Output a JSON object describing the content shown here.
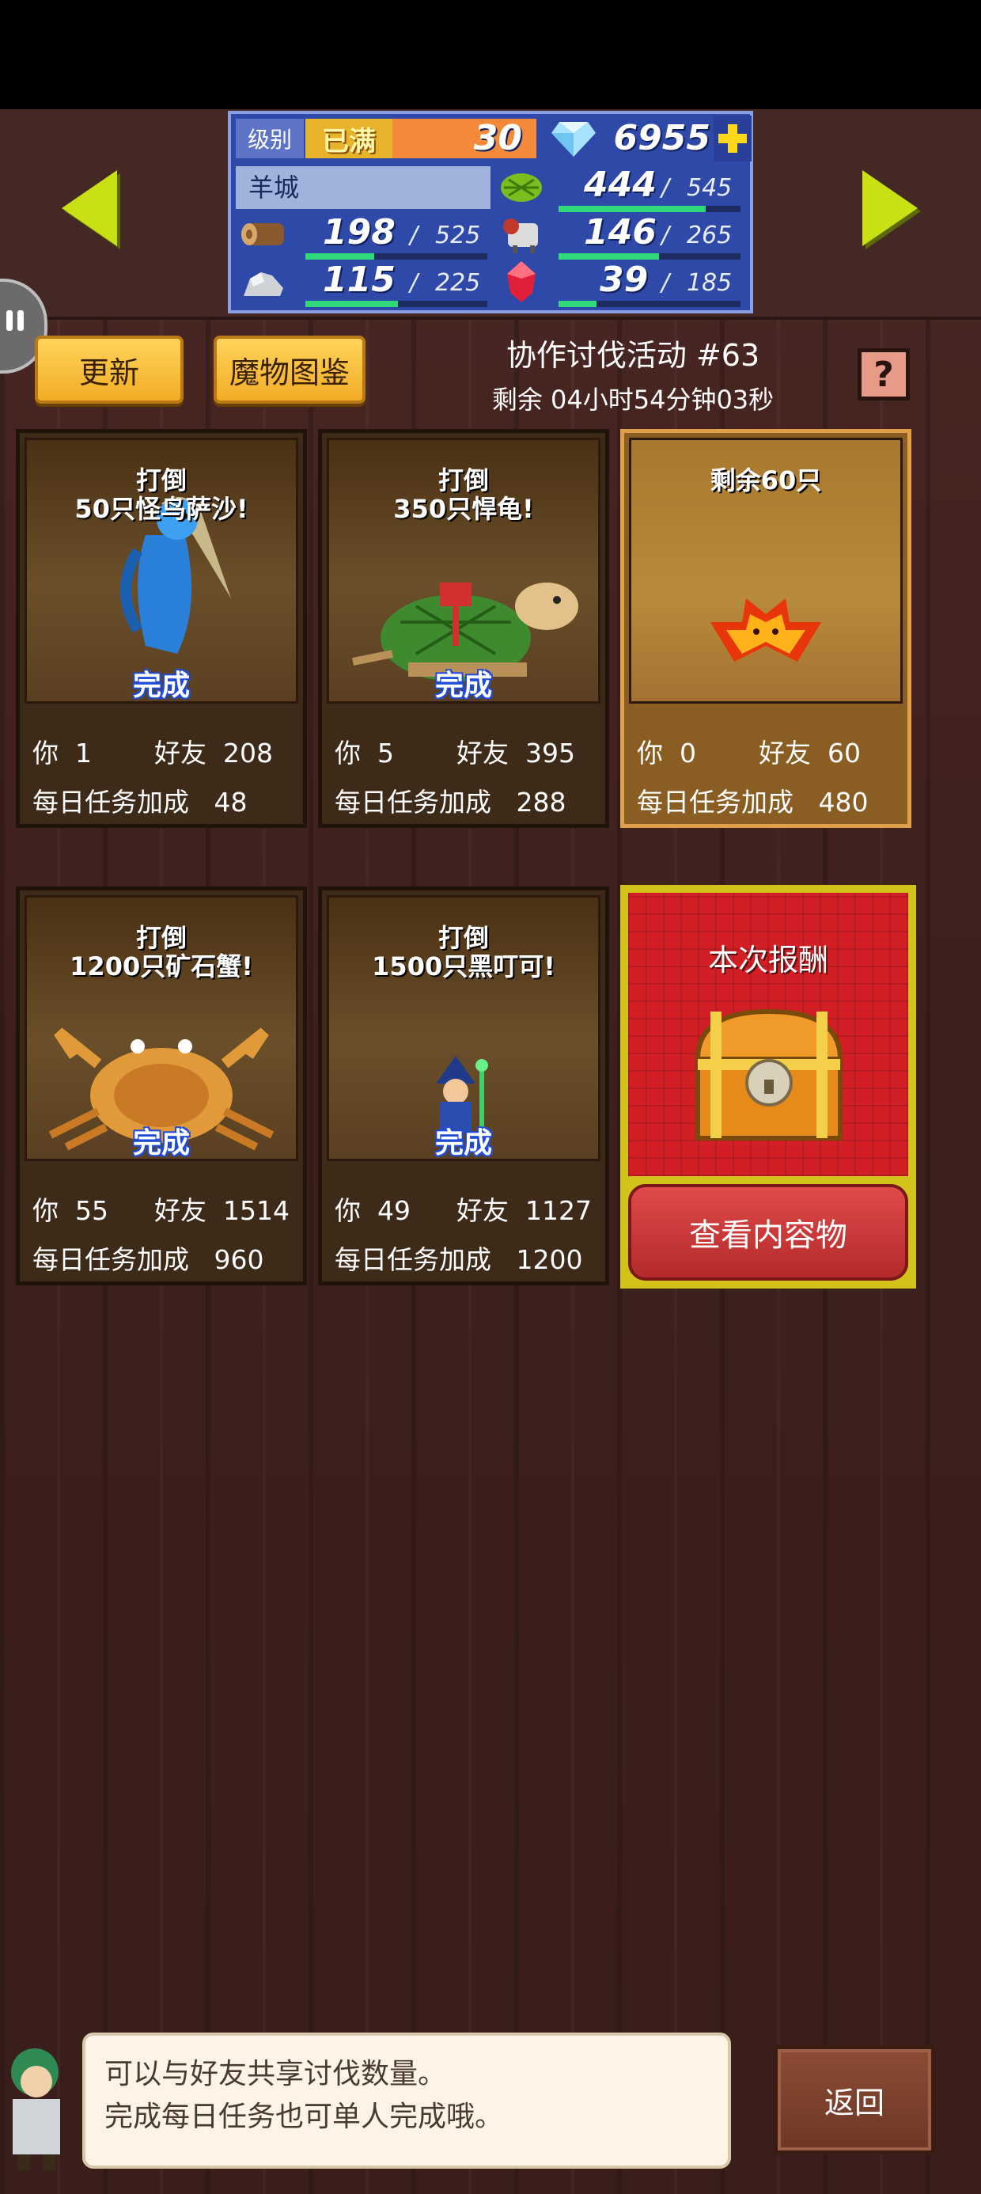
{
  "stats": {
    "level_label": "级别",
    "max_badge": "已满",
    "level": "30",
    "gems": "6955",
    "town": "羊城",
    "res1": {
      "value": "444",
      "sep": "/",
      "max": "545",
      "fill": 0.81
    },
    "wood": {
      "value": "198",
      "sep": "/",
      "max": "525",
      "fill": 0.38
    },
    "res3": {
      "value": "146",
      "sep": "/",
      "max": "265",
      "fill": 0.55
    },
    "stone": {
      "value": "115",
      "sep": "/",
      "max": "225",
      "fill": 0.51
    },
    "ruby": {
      "value": "39",
      "sep": "/",
      "max": "185",
      "fill": 0.21
    },
    "add_icon": "plus-icon"
  },
  "toolbar": {
    "refresh_label": "更新",
    "bestiary_label": "魔物图鉴"
  },
  "event": {
    "title": "协作讨伐活动 #63",
    "remaining": "剩余 04小时54分钟03秒",
    "help_icon": "?"
  },
  "labels": {
    "you": "你",
    "friends": "好友",
    "daily_bonus": "每日任务加成",
    "done": "完成"
  },
  "cards": [
    {
      "title": "打倒\n50只怪鸟萨沙!",
      "you": "1",
      "friends": "208",
      "bonus": "48",
      "done": true
    },
    {
      "title": "打倒\n350只悍龟!",
      "you": "5",
      "friends": "395",
      "bonus": "288",
      "done": true
    },
    {
      "title": "剩余60只",
      "you": "0",
      "friends": "60",
      "bonus": "480",
      "done": false
    },
    {
      "title": "打倒\n1200只矿石蟹!",
      "you": "55",
      "friends": "1514",
      "bonus": "960",
      "done": true
    },
    {
      "title": "打倒\n1500只黑叮可!",
      "you": "49",
      "friends": "1127",
      "bonus": "1200",
      "done": true
    }
  ],
  "reward": {
    "title": "本次报酬",
    "view_label": "查看内容物"
  },
  "tip": {
    "line1": "可以与好友共享讨伐数量。",
    "line2": "完成每日任务也可单人完成哦。"
  },
  "back_label": "返回",
  "colors": {
    "accent_green": "#c8e014",
    "stat_panel": "#2f49a8",
    "reward_red": "#d11f25",
    "button_yellow": "#f2ad26"
  }
}
